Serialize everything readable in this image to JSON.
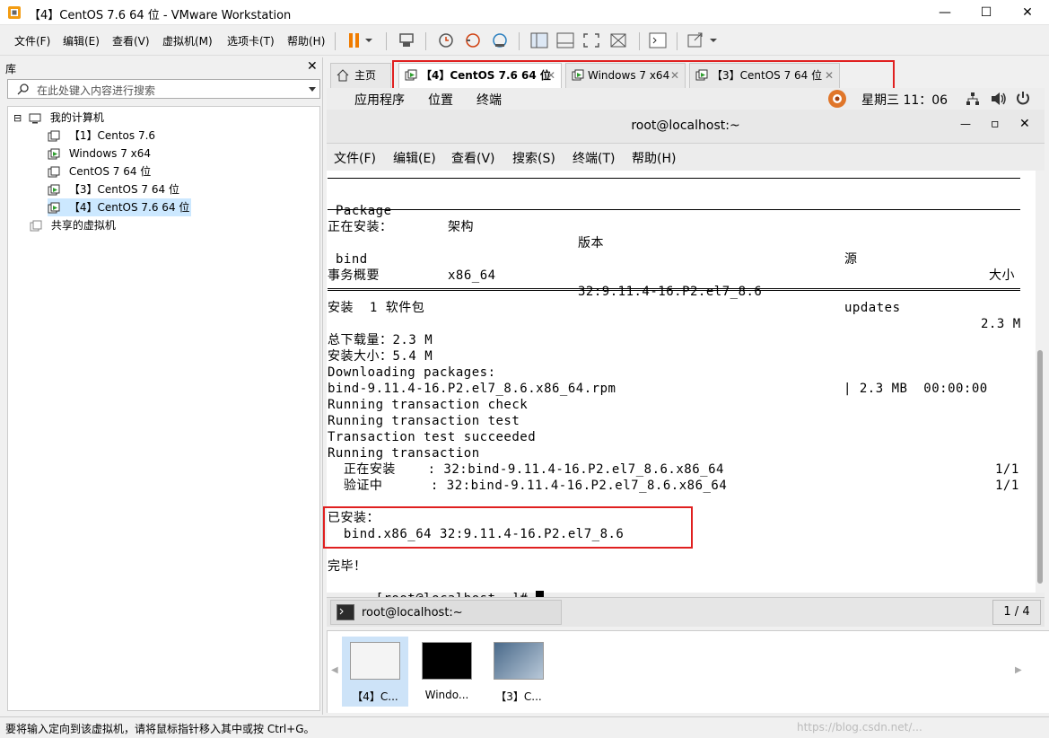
{
  "window": {
    "title": "【4】CentOS 7.6 64 位 - VMware Workstation",
    "minimize": "—",
    "maximize": "☐",
    "close": "✕"
  },
  "menu": {
    "file": "文件(F)",
    "edit": "编辑(E)",
    "view": "查看(V)",
    "vm": "虚拟机(M)",
    "tabs": "选项卡(T)",
    "help": "帮助(H)"
  },
  "library": {
    "header": "库",
    "close": "✕",
    "search_placeholder": "在此处键入内容进行搜索",
    "tree": {
      "root": "我的计算机",
      "items": [
        "【1】Centos 7.6",
        "Windows 7 x64",
        "CentOS 7 64 位",
        "【3】CentOS 7 64 位",
        "【4】CentOS 7.6 64 位"
      ],
      "shared": "共享的虚拟机"
    },
    "expander": "⊟"
  },
  "tabs": {
    "home": "主页",
    "items": [
      {
        "label": "【4】CentOS 7.6 64 位",
        "close": "✕"
      },
      {
        "label": "Windows 7 x64",
        "close": "✕"
      },
      {
        "label": "【3】CentOS 7 64 位",
        "close": "✕"
      }
    ]
  },
  "gnome": {
    "apps": "应用程序",
    "places": "位置",
    "terminal": "终端",
    "clock": "星期三 11：06"
  },
  "terminal": {
    "title": "root@localhost:~",
    "menu": [
      "文件(F)",
      "编辑(E)",
      "查看(V)",
      "搜索(S)",
      "终端(T)",
      "帮助(H)"
    ],
    "win_min": "—",
    "win_max": "▫",
    "win_close": "✕",
    "header_cols": [
      "Package",
      "架构",
      "版本",
      "源",
      "大小"
    ],
    "installing_label": "正在安装：",
    "pkg_row": [
      "bind",
      "x86_64",
      "32:9.11.4-16.P2.el7_8.6",
      "updates",
      "2.3 M"
    ],
    "summary_label": "事务概要",
    "install_count": "安装  1 软件包",
    "download_size": "总下载量：2.3 M",
    "install_size": "安装大小：5.4 M",
    "lines": [
      "Downloading packages:",
      "bind-9.11.4-16.P2.el7_8.6.x86_64.rpm",
      "Running transaction check",
      "Running transaction test",
      "Transaction test succeeded",
      "Running transaction"
    ],
    "download_progress": "| 2.3 MB  00:00:00",
    "progress_rows": [
      {
        "label": "  正在安装    : 32:bind-9.11.4-16.P2.el7_8.6.x86_64",
        "count": "1/1"
      },
      {
        "label": "  验证中      : 32:bind-9.11.4-16.P2.el7_8.6.x86_64",
        "count": "1/1"
      }
    ],
    "installed_label": "已安装：",
    "installed_pkg": "  bind.x86_64 32:9.11.4-16.P2.el7_8.6",
    "done": "完毕！",
    "prompt": "[root@localhost ~]# ",
    "task_label": "root@localhost:~",
    "pager": "1 / 4"
  },
  "thumbnails": [
    {
      "caption": "【4】C..."
    },
    {
      "caption": "Windo..."
    },
    {
      "caption": "【3】C..."
    }
  ],
  "status": {
    "text": "要将输入定向到该虚拟机，请将鼠标指针移入其中或按 Ctrl+G。",
    "watermark": "https://blog.csdn.net/..."
  },
  "colors": {
    "highlight_red": "#e02020",
    "selection_blue": "#cce8ff"
  }
}
